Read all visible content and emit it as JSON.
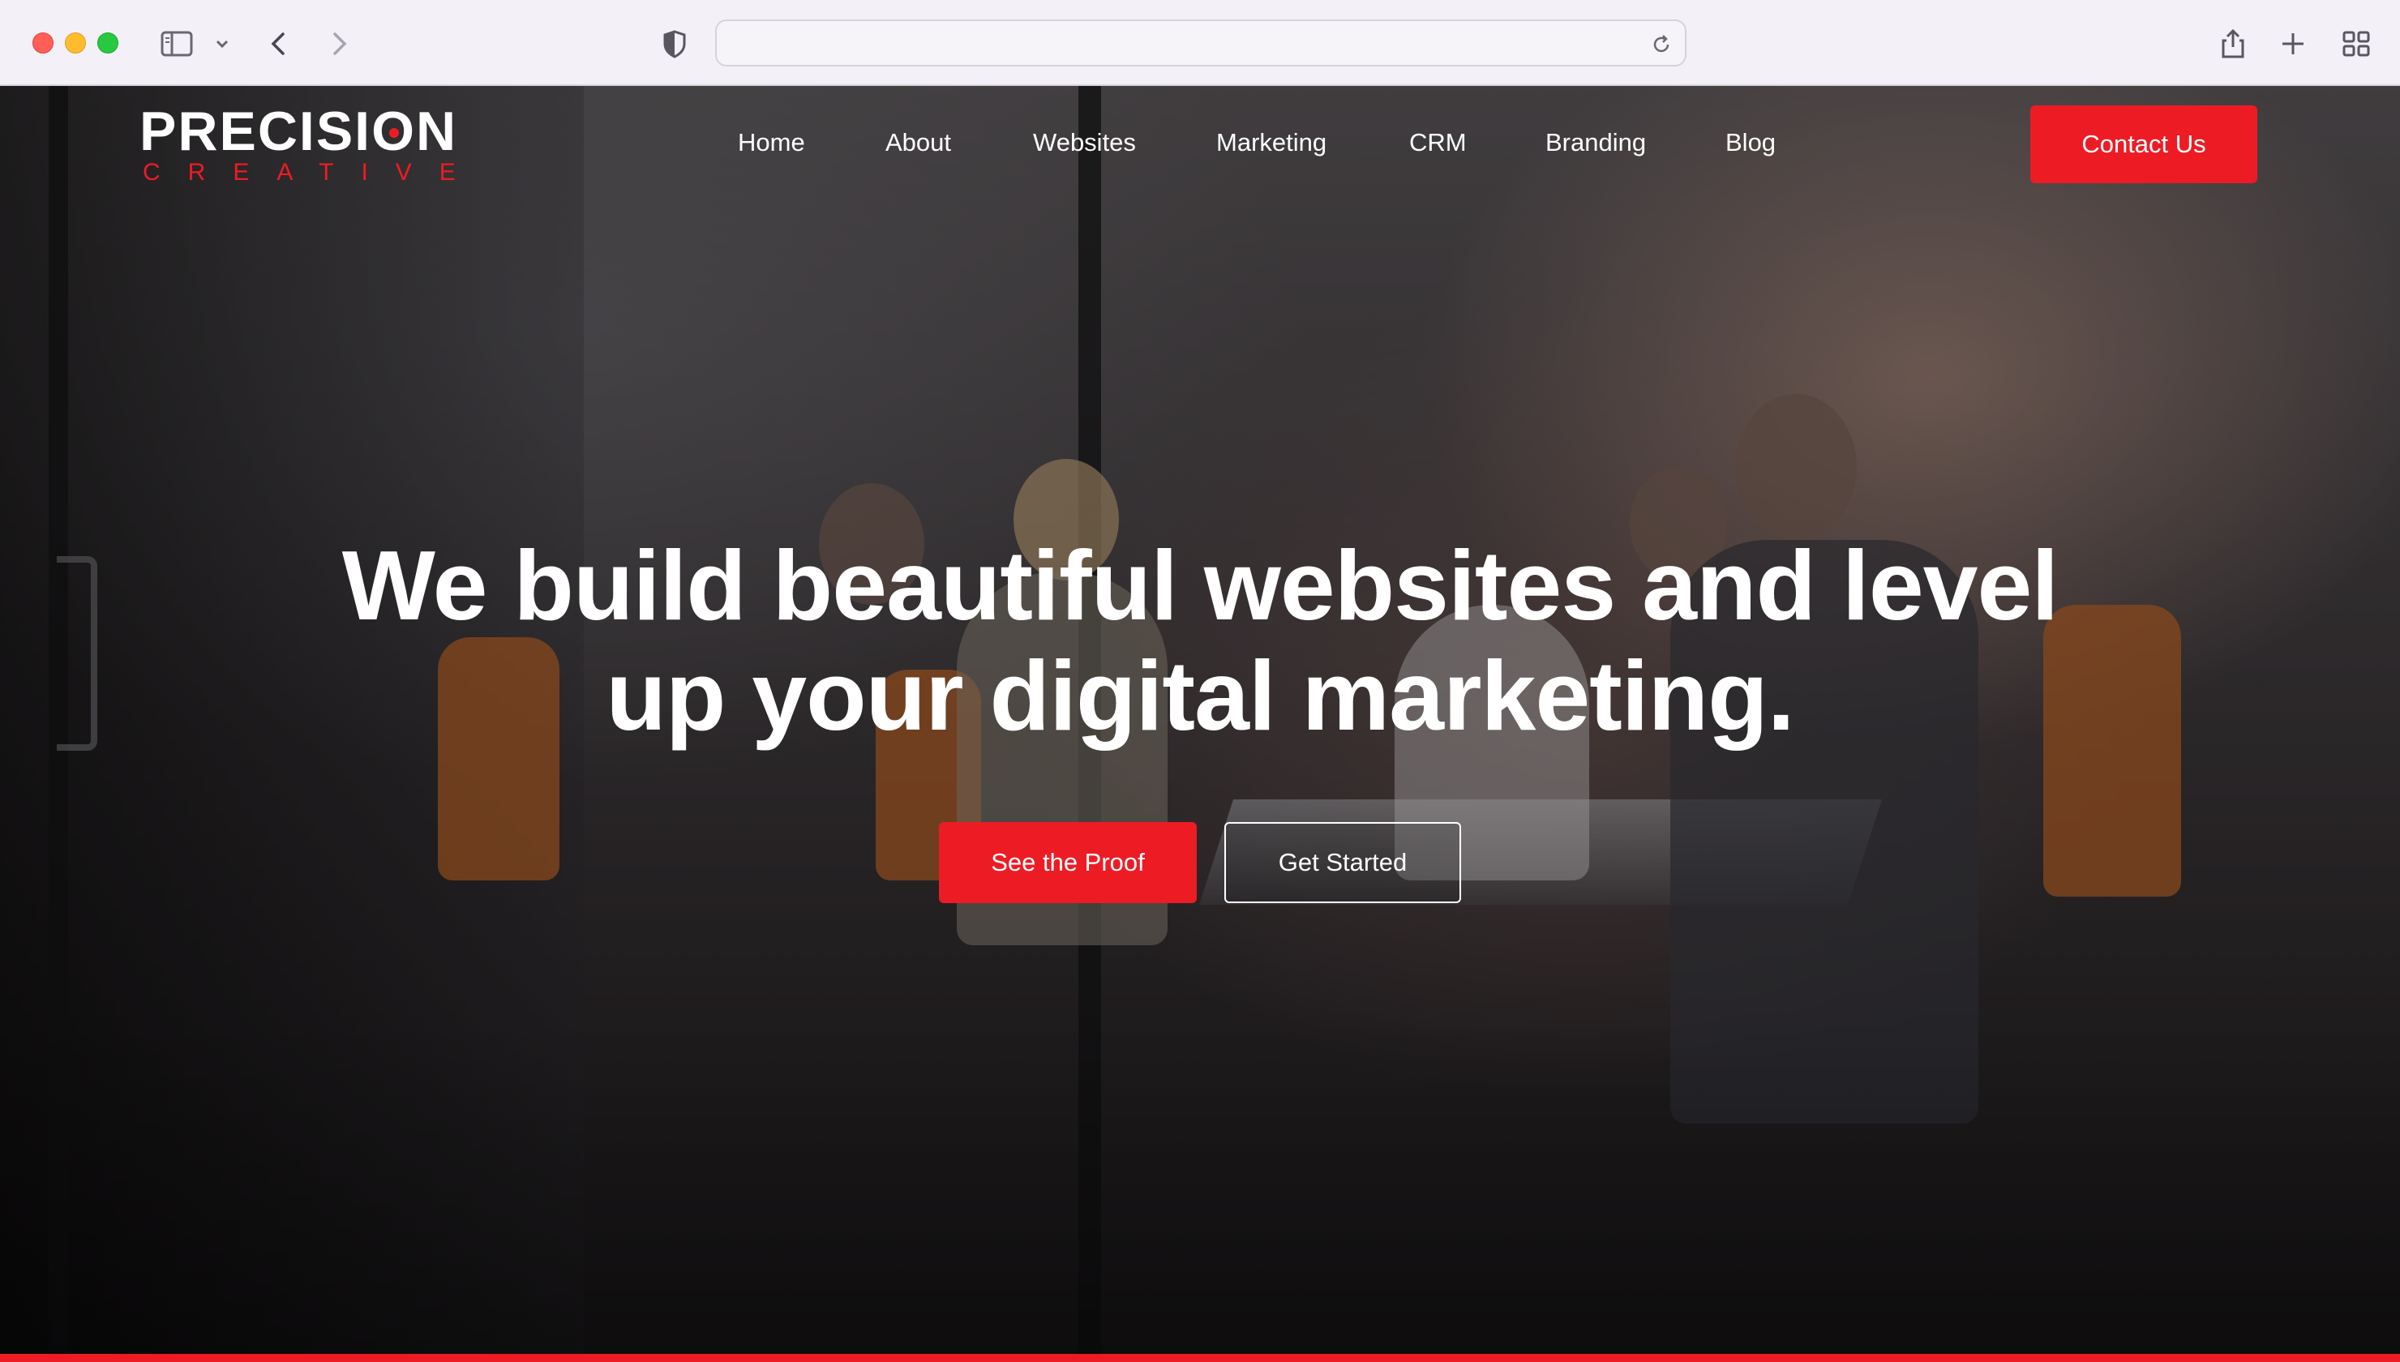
{
  "browser": {
    "url": "",
    "icons": [
      "sidebar-icon",
      "chevron-down-icon",
      "back-icon",
      "forward-icon",
      "shield-icon",
      "reload-icon",
      "share-icon",
      "new-tab-icon",
      "tab-overview-icon"
    ]
  },
  "site": {
    "logo": {
      "main": "PRECISION",
      "sub": "CREATIVE"
    },
    "nav": [
      {
        "label": "Home"
      },
      {
        "label": "About"
      },
      {
        "label": "Websites"
      },
      {
        "label": "Marketing"
      },
      {
        "label": "CRM"
      },
      {
        "label": "Branding"
      },
      {
        "label": "Blog"
      }
    ],
    "contact_label": "Contact Us"
  },
  "hero": {
    "headline_line1": "We build beautiful websites and level",
    "headline_line2": "up your digital marketing.",
    "primary_cta": "See the Proof",
    "secondary_cta": "Get Started"
  },
  "colors": {
    "accent": "#ed1c24",
    "text": "#ffffff",
    "chrome_bg": "#f4f0f7"
  }
}
